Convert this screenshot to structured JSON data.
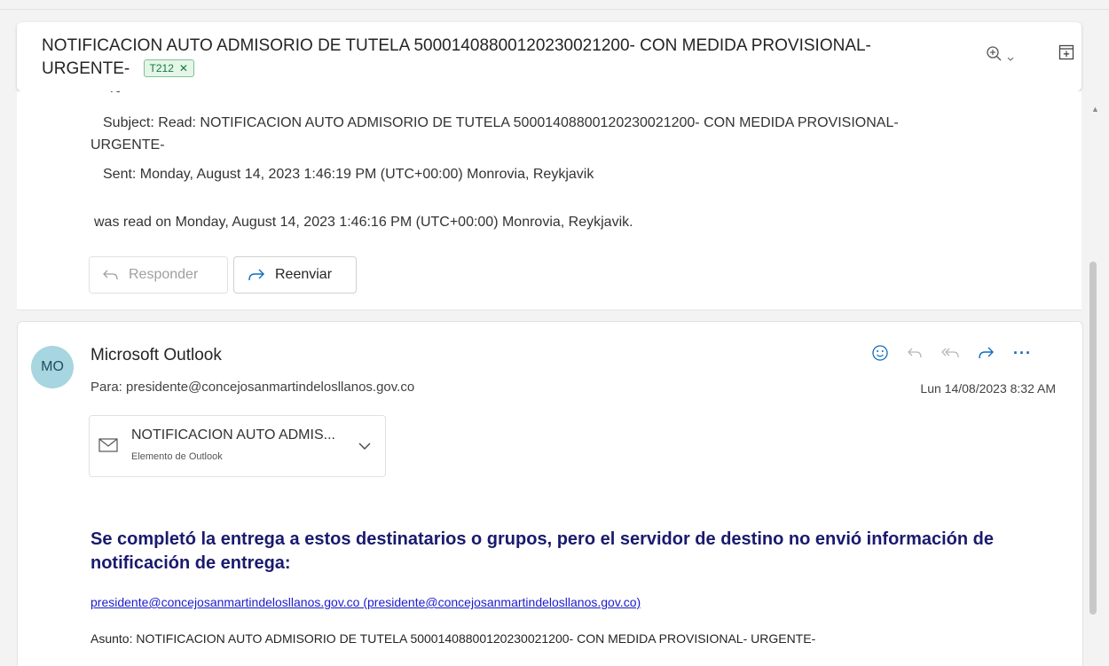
{
  "header": {
    "subject": "NOTIFICACION AUTO ADMISORIO DE TUTELA 50001408800120230021200- CON MEDIDA PROVISIONAL- URGENTE-",
    "tag": "T212",
    "zoom_icon": "zoom-in-icon",
    "popout_icon": "open-in-new-window-icon"
  },
  "previous_message": {
    "subject_line": "Subject: Read: NOTIFICACION AUTO ADMISORIO DE TUTELA 50001408800120230021200- CON MEDIDA PROVISIONAL-",
    "subject_line_cont": "URGENTE-",
    "sent_line": "Sent: Monday, August 14, 2023 1:46:19 PM (UTC+00:00) Monrovia, Reykjavik",
    "read_line": "was read on Monday, August 14, 2023 1:46:16 PM (UTC+00:00) Monrovia, Reykjavik.",
    "reply_label": "Responder",
    "forward_label": "Reenviar"
  },
  "message": {
    "avatar_initials": "MO",
    "sender": "Microsoft Outlook",
    "to": "Para:  presidente@concejosanmartindelosllanos.gov.co",
    "date": "Lun 14/08/2023 8:32 AM",
    "actions": [
      "emoji-icon",
      "reply-icon",
      "reply-all-icon",
      "forward-icon",
      "more-icon"
    ],
    "attachment": {
      "name": "NOTIFICACION AUTO ADMIS...",
      "type": "Elemento de Outlook"
    },
    "notice": "Se completó la entrega a estos destinatarios o grupos, pero el servidor de destino no envió información de notificación de entrega:",
    "recipient_link": "presidente@concejosanmartindelosllanos.gov.co (presidente@concejosanmartindelosllanos.gov.co)",
    "asunto": "Asunto: NOTIFICACION AUTO ADMISORIO DE TUTELA 50001408800120230021200- CON MEDIDA PROVISIONAL- URGENTE-"
  },
  "colors": {
    "accent": "#0f6cbd",
    "tag_green": "#107c41",
    "notice_blue": "#1a1a6e",
    "avatar_bg": "#a7d5e0"
  }
}
